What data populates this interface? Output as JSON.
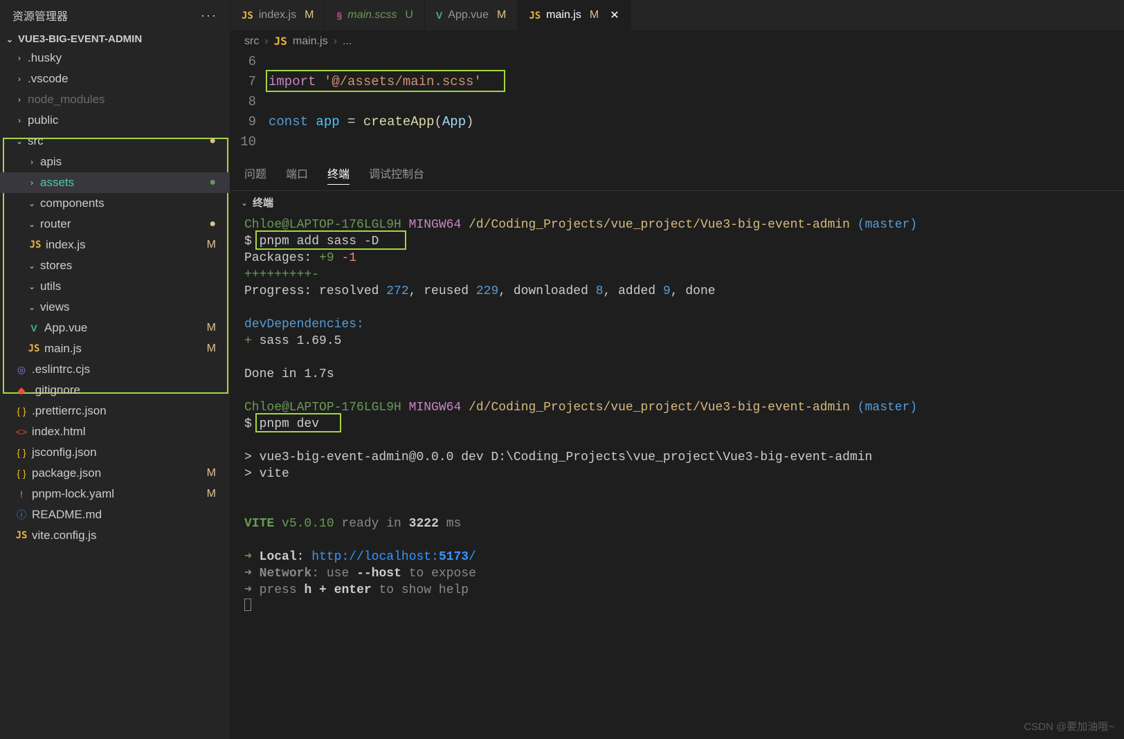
{
  "explorer": {
    "title": "资源管理器",
    "project": "VUE3-BIG-EVENT-ADMIN"
  },
  "tree": [
    {
      "d": 1,
      "exp": "closed",
      "name": ".husky",
      "type": "folder"
    },
    {
      "d": 1,
      "exp": "closed",
      "name": ".vscode",
      "type": "folder"
    },
    {
      "d": 1,
      "exp": "closed",
      "name": "node_modules",
      "type": "folder",
      "dim": true
    },
    {
      "d": 1,
      "exp": "closed",
      "name": "public",
      "type": "folder"
    },
    {
      "d": 1,
      "exp": "open",
      "name": "src",
      "type": "folder",
      "badge": "●",
      "badgeClass": "dot"
    },
    {
      "d": 2,
      "exp": "closed",
      "name": "apis",
      "type": "folder"
    },
    {
      "d": 2,
      "exp": "closed",
      "name": "assets",
      "type": "folder",
      "selected": true,
      "badge": "●",
      "badgeClass": "dot-green"
    },
    {
      "d": 2,
      "exp": "open",
      "name": "components",
      "type": "folder"
    },
    {
      "d": 2,
      "exp": "open",
      "name": "router",
      "type": "folder",
      "badge": "●",
      "badgeClass": "dot"
    },
    {
      "d": 3,
      "icon": "js",
      "name": "index.js",
      "type": "file",
      "badge": "M",
      "badgeClass": "M"
    },
    {
      "d": 2,
      "exp": "open",
      "name": "stores",
      "type": "folder"
    },
    {
      "d": 2,
      "exp": "open",
      "name": "utils",
      "type": "folder"
    },
    {
      "d": 2,
      "exp": "open",
      "name": "views",
      "type": "folder"
    },
    {
      "d": 2,
      "icon": "vue",
      "name": "App.vue",
      "type": "file",
      "badge": "M",
      "badgeClass": "M"
    },
    {
      "d": 2,
      "icon": "js",
      "name": "main.js",
      "type": "file",
      "badge": "M",
      "badgeClass": "M"
    },
    {
      "d": 1,
      "icon": "eslint",
      "name": ".eslintrc.cjs",
      "type": "file"
    },
    {
      "d": 1,
      "icon": "git",
      "name": ".gitignore",
      "type": "file"
    },
    {
      "d": 1,
      "icon": "json",
      "name": ".prettierrc.json",
      "type": "file"
    },
    {
      "d": 1,
      "icon": "html",
      "name": "index.html",
      "type": "file"
    },
    {
      "d": 1,
      "icon": "json",
      "name": "jsconfig.json",
      "type": "file"
    },
    {
      "d": 1,
      "icon": "json",
      "name": "package.json",
      "type": "file",
      "badge": "M",
      "badgeClass": "M"
    },
    {
      "d": 1,
      "icon": "lock",
      "name": "pnpm-lock.yaml",
      "type": "file",
      "badge": "M",
      "badgeClass": "M"
    },
    {
      "d": 1,
      "icon": "info",
      "name": "README.md",
      "type": "file"
    },
    {
      "d": 1,
      "icon": "js",
      "name": "vite.config.js",
      "type": "file"
    }
  ],
  "tabs": [
    {
      "icon": "js",
      "name": "index.js",
      "status": "M"
    },
    {
      "icon": "scss",
      "name": "main.scss",
      "status": "U",
      "italic": true
    },
    {
      "icon": "vue",
      "name": "App.vue",
      "status": "M"
    },
    {
      "icon": "js",
      "name": "main.js",
      "status": "M",
      "active": true,
      "close": true
    }
  ],
  "breadcrumb": {
    "seg1": "src",
    "seg2": "main.js",
    "seg3": "..."
  },
  "code": {
    "lines": [
      "6",
      "7",
      "8",
      "9",
      "10"
    ],
    "l7_import": "import ",
    "l7_str": "'@/assets/main.scss'",
    "l9_const": "const ",
    "l9_app": "app",
    "l9_eq": " = ",
    "l9_fn": "createApp",
    "l9_paren_o": "(",
    "l9_arg": "App",
    "l9_paren_c": ")"
  },
  "panelTabs": {
    "problems": "问题",
    "ports": "端口",
    "terminal": "终端",
    "debug": "调试控制台"
  },
  "terminalTitle": "终端",
  "terminal": {
    "prompt_user": "Chloe@LAPTOP-176LGL9H",
    "prompt_shell": "MINGW64",
    "prompt_path": "/d/Coding_Projects/vue_project/Vue3-big-event-admin",
    "prompt_branch": "(master)",
    "dollar": "$ ",
    "cmd1": "pnpm add sass -D",
    "packages_label": "Packages: ",
    "packages_plus": "+9 ",
    "packages_minus": "-1",
    "plusline": "+++++++++-",
    "progress": "Progress: resolved ",
    "prog_272": "272",
    "prog_reused": ", reused ",
    "prog_229": "229",
    "prog_dl": ", downloaded ",
    "prog_8": "8",
    "prog_added": ", added ",
    "prog_9": "9",
    "prog_done": ", done",
    "devdeps": "devDependencies:",
    "sass_plus": "+ ",
    "sass": "sass 1.69.5",
    "done": "Done in 1.7s",
    "cmd2": "pnpm dev",
    "run1": "> vue3-big-event-admin@0.0.0 dev D:\\Coding_Projects\\vue_project\\Vue3-big-event-admin",
    "run2": "> vite",
    "vite": "VITE ",
    "vite_ver": "v5.0.10",
    "vite_ready": "  ready in ",
    "vite_ms": "3222",
    "vite_ms_suffix": " ms",
    "arrow": "➜  ",
    "local": "Local",
    "local_sep": ":   ",
    "local_url": "http://localhost:",
    "local_port": "5173",
    "local_slash": "/",
    "network": "Network",
    "network_txt": ": use ",
    "network_flag": "--host",
    "network_txt2": " to expose",
    "press": "press ",
    "press_keys": "h + enter",
    "press_txt": " to show help"
  },
  "watermark": "CSDN @要加油哦~"
}
